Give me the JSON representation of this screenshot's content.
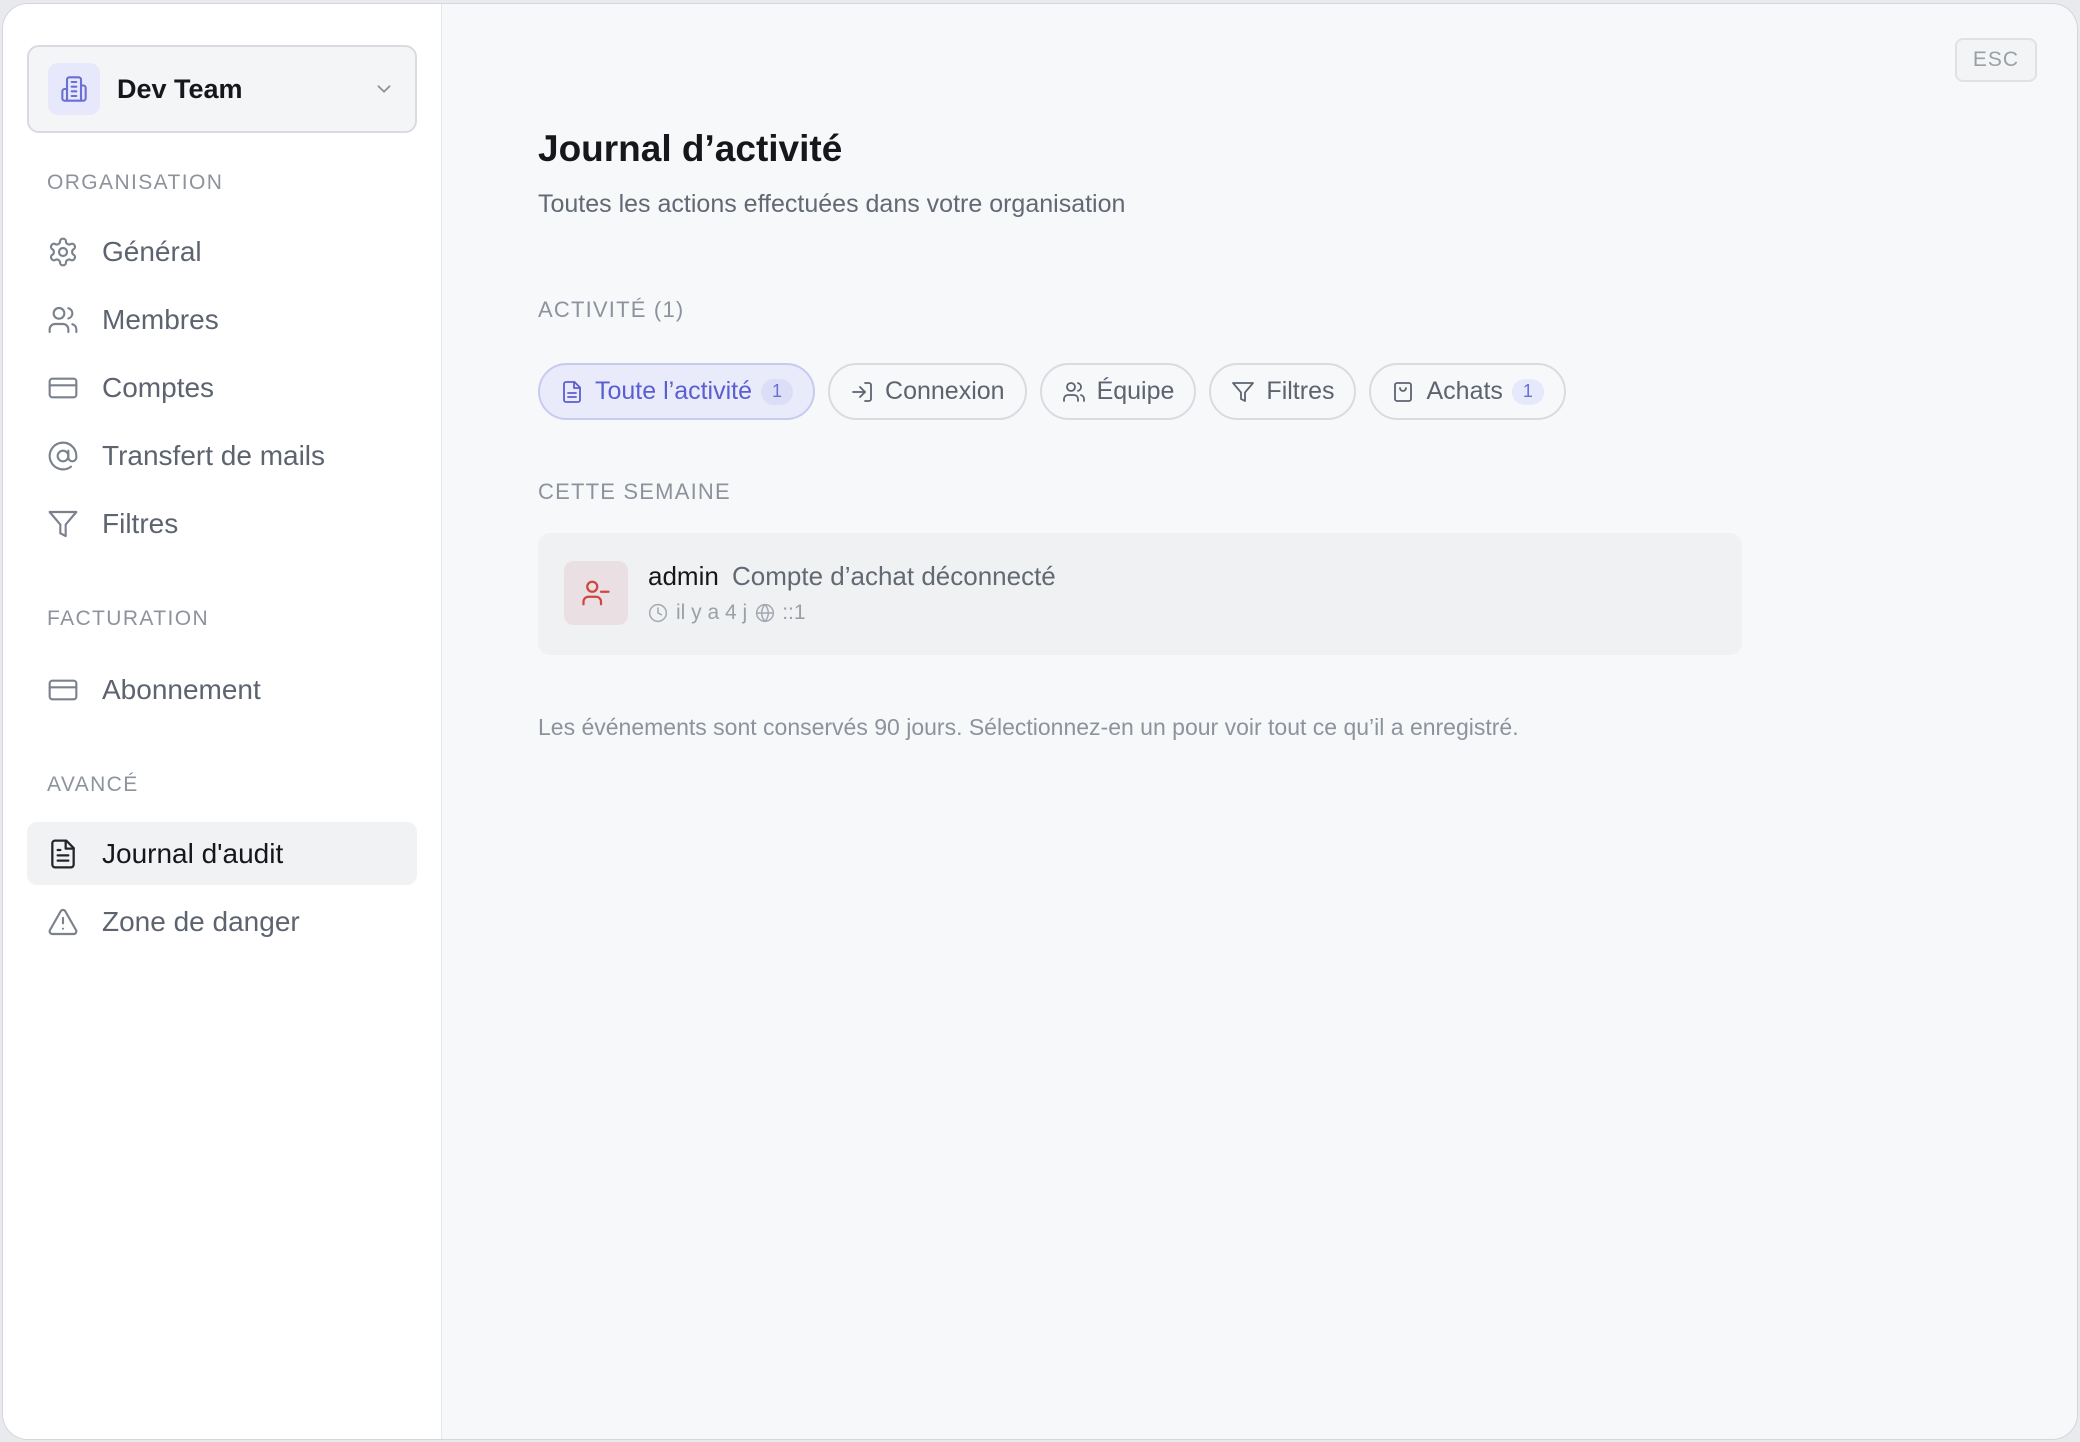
{
  "sidebar": {
    "team": {
      "name": "Dev Team",
      "logo_icon": "building-icon",
      "toggle_icon": "chevron-down-icon"
    },
    "sections": [
      {
        "title": "ORGANISATION",
        "items": [
          {
            "label": "Général",
            "icon": "gear-icon"
          },
          {
            "label": "Membres",
            "icon": "users-icon"
          },
          {
            "label": "Comptes",
            "icon": "credit-card-icon"
          },
          {
            "label": "Transfert de mails",
            "icon": "at-sign-icon"
          },
          {
            "label": "Filtres",
            "icon": "filter-icon"
          }
        ]
      },
      {
        "title": "FACTURATION",
        "items": [
          {
            "label": "Abonnement",
            "icon": "credit-card-icon"
          }
        ]
      },
      {
        "title": "AVANCÉ",
        "items": [
          {
            "label": "Journal d'audit",
            "icon": "document-icon",
            "active": true
          },
          {
            "label": "Zone de danger",
            "icon": "warning-icon"
          }
        ]
      }
    ]
  },
  "close": {
    "label": "ESC"
  },
  "page": {
    "title": "Journal d’activité",
    "subtitle": "Toutes les actions effectuées dans votre organisation"
  },
  "activity": {
    "heading": "ACTIVITÉ (1)",
    "refresh_icon": "refresh-icon",
    "filters": [
      {
        "label": "Toute l’activité",
        "icon": "document-icon",
        "count": "1",
        "active": true
      },
      {
        "label": "Connexion",
        "icon": "login-icon"
      },
      {
        "label": "Équipe",
        "icon": "users-icon"
      },
      {
        "label": "Filtres",
        "icon": "filter-icon"
      },
      {
        "label": "Achats",
        "icon": "shopping-bag-icon",
        "count": "1"
      }
    ],
    "group_title": "CETTE SEMAINE",
    "events": [
      {
        "actor": "admin",
        "action": "Compte d’achat déconnecté",
        "time": "il y a 4 j",
        "ip": "::1",
        "icon": "user-minus-icon",
        "icon_color": "#d0463f"
      }
    ],
    "footer": "Les événements sont conservés 90 jours. Sélectionnez-en un pour voir tout ce qu’il a enregistré."
  },
  "colors": {
    "accent": "#5a5fd0",
    "danger": "#d0463f",
    "muted_text": "#8d939c"
  }
}
